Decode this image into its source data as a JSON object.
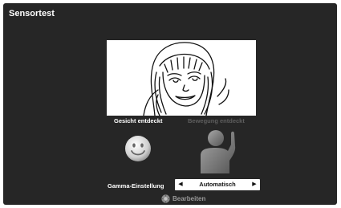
{
  "app": {
    "title": "Sensortest"
  },
  "preview": {
    "icon": "woman-face-line-drawing"
  },
  "status": {
    "face_detected": "Gesicht entdeckt",
    "motion_detected": "Bewegung entdeckt",
    "face_icon": "smiley-icon",
    "motion_icon": "waving-person-icon"
  },
  "gamma": {
    "label": "Gamma-Einstellung",
    "value": "Automatisch"
  },
  "footer": {
    "edit_label": "Bearbeiten",
    "edit_icon": "remote-button-icon"
  },
  "colors": {
    "background": "#262626",
    "active_text": "#ffffff",
    "inactive_text": "#5e5e5e"
  }
}
